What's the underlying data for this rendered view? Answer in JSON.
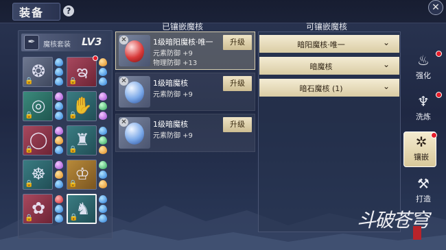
{
  "header": {
    "title": "装备",
    "help_label": "?",
    "close_label": "✕"
  },
  "equip_set": {
    "name": "魔核套装",
    "level": "LV3"
  },
  "equipment": [
    {
      "slot": "helmet",
      "glyph": "❂",
      "color": "grey",
      "gems": [
        "b",
        "b",
        "b"
      ]
    },
    {
      "slot": "necklace",
      "glyph": "ఇ",
      "color": "red",
      "gems": [
        "o",
        "b",
        "b"
      ],
      "dot": true
    },
    {
      "slot": "bracelet",
      "glyph": "◎",
      "color": "green",
      "gems": [
        "p",
        "b",
        "b"
      ]
    },
    {
      "slot": "gloves",
      "glyph": "✋",
      "color": "teal",
      "gems": [
        "p",
        "g",
        "p"
      ]
    },
    {
      "slot": "ring",
      "glyph": "◯",
      "color": "red",
      "gems": [
        "p",
        "o",
        "b"
      ]
    },
    {
      "slot": "armor",
      "glyph": "♜",
      "color": "teal",
      "gems": [
        "b",
        "g",
        "o"
      ]
    },
    {
      "slot": "amulet",
      "glyph": "☸",
      "color": "teal",
      "gems": [
        "p",
        "o",
        "b"
      ]
    },
    {
      "slot": "belt",
      "glyph": "♔",
      "color": "gold",
      "gems": [
        "g",
        "b",
        "o"
      ]
    },
    {
      "slot": "pendant",
      "glyph": "✿",
      "color": "red",
      "gems": [
        "r",
        "b",
        "b"
      ]
    },
    {
      "slot": "boots",
      "glyph": "♞",
      "color": "teal",
      "gems": [
        "b",
        "b",
        "b"
      ],
      "selected": true
    }
  ],
  "inlaid": {
    "title": "已镶嵌魔核",
    "upgrade_label": "升级",
    "items": [
      {
        "name": "1级暗阳魔核·唯一",
        "stats": [
          "元素防御 +9",
          "物理防御 +13"
        ],
        "orb": "red"
      },
      {
        "name": "1级暗魔核",
        "stats": [
          "元素防御 +9"
        ],
        "orb": "blue"
      },
      {
        "name": "1级暗魔核",
        "stats": [
          "元素防御 +9"
        ],
        "orb": "blue"
      }
    ]
  },
  "available": {
    "title": "可镶嵌魔核",
    "options": [
      "暗阳魔核·唯一",
      "暗魔核",
      "暗石魔核 (1)"
    ]
  },
  "tabs": [
    {
      "label": "强化",
      "icon": "♨",
      "dot": true
    },
    {
      "label": "洗炼",
      "icon": "♆",
      "dot": true
    },
    {
      "label": "镶嵌",
      "icon": "✲",
      "dot": true,
      "active": true
    },
    {
      "label": "打造",
      "icon": "⚒",
      "dot": false
    }
  ],
  "logo": "斗破苍穹"
}
